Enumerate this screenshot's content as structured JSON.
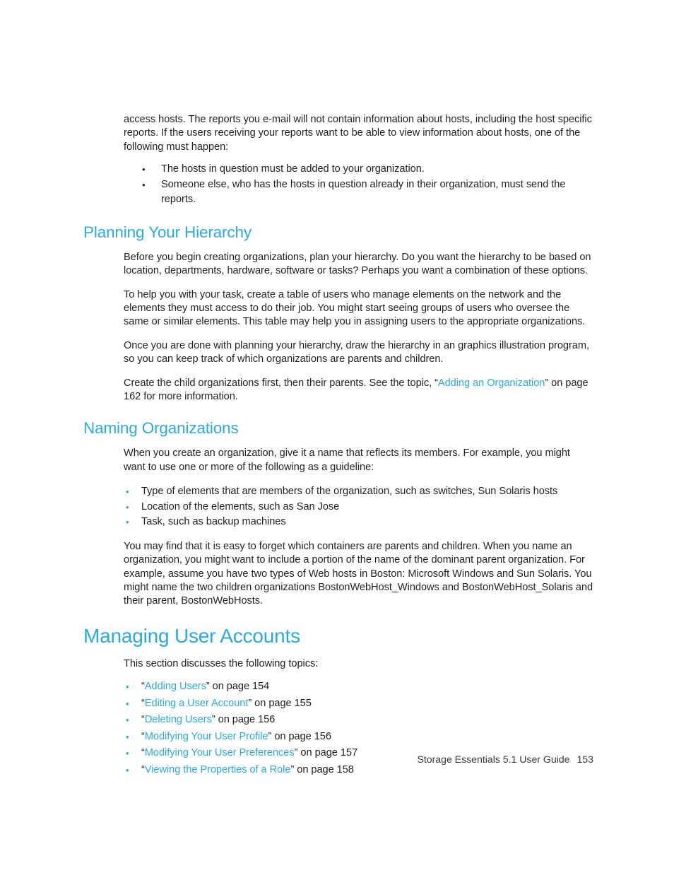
{
  "document": {
    "guide_title": "Storage Essentials 5.1 User Guide",
    "page_number": "153",
    "accent_color": "#29abe2",
    "text_color": "#231f20"
  },
  "continued_paragraph": {
    "text": "access hosts. The reports you e-mail will not contain information about hosts, including the host specific reports. If the users receiving your reports want to be able to view information about hosts, one of the following must happen:"
  },
  "hosts_list": {
    "bullet_glyph": "•",
    "items": [
      "The hosts in question must be added to your organization.",
      "Someone else, who has the hosts in question already in their organization, must send the reports."
    ]
  },
  "planning_section": {
    "heading": "Planning Your Hierarchy",
    "paragraphs": [
      "Before you begin creating organizations, plan your hierarchy. Do you want the hierarchy to be based on location, departments, hardware, software or tasks? Perhaps you want a combination of these options.",
      "To help you with your task, create a table of users who manage elements on the network and the elements they must access to do their job. You might start seeing groups of users who oversee the same or similar elements. This table may help you in assigning users to the appropriate organizations.",
      "Once you are done with planning your hierarchy, draw the hierarchy in an graphics illustration program, so you can keep track of which organizations are parents and children."
    ],
    "xref_sentence": {
      "before": "Create the child organizations first, then their parents. See the topic, “",
      "link": "Adding an Organization",
      "after": "” on page 162 for more information."
    }
  },
  "naming_section": {
    "heading": "Naming Organizations",
    "intro": "When you create an organization, give it a name that reflects its members. For example, you might want to use one or more of the following as a guideline:",
    "bullet_glyph": "•",
    "guidelines": [
      "Type of elements that are members of the organization, such as switches, Sun Solaris hosts",
      "Location of the elements, such as San Jose",
      "Task, such as backup machines"
    ],
    "closing_paragraph": "You may find that it is easy to forget which containers are parents and children. When you name an organization, you might want to include a portion of the name of the dominant parent organization. For example, assume you have two types of Web hosts in Boston: Microsoft Windows and Sun Solaris. You might name the two children organizations BostonWebHost_Windows and BostonWebHost_Solaris and their parent, BostonWebHosts."
  },
  "managing_users_section": {
    "heading": "Managing User Accounts",
    "intro": "This section discusses the following topics:",
    "bullet_glyph": "•",
    "open_quote": "“",
    "close_quote": "”",
    "topics": [
      {
        "link": "Adding Users",
        "page_ref": " on page 154"
      },
      {
        "link": "Editing a User Account",
        "page_ref": " on page 155"
      },
      {
        "link": "Deleting Users",
        "page_ref": " on page 156"
      },
      {
        "link": "Modifying Your User Profile",
        "page_ref": " on page 156"
      },
      {
        "link": "Modifying Your User Preferences",
        "page_ref": " on page 157"
      },
      {
        "link": "Viewing the Properties of a Role",
        "page_ref": " on page 158"
      }
    ]
  }
}
